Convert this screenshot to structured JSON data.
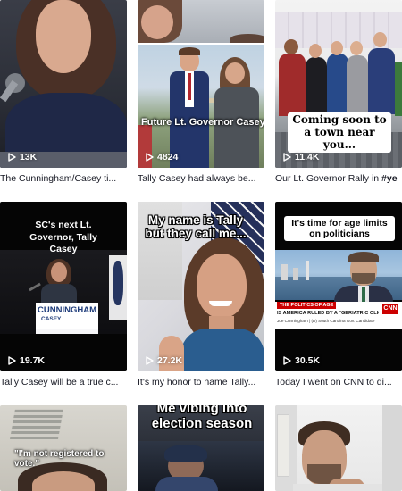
{
  "videos": [
    {
      "views": "13K",
      "caption": "The Cunningham/Casey ti...",
      "caption_highlight": ""
    },
    {
      "views": "4824",
      "caption": "Tally Casey had always be...",
      "caption_highlight": "",
      "overlay": "Future Lt. Governor Casey"
    },
    {
      "views": "11.4K",
      "caption": "Our Lt. Governor Rally in ",
      "caption_highlight": "#ye",
      "overlay": "Coming soon to a town near you..."
    },
    {
      "views": "19.7K",
      "caption": "Tally Casey will be a true c...",
      "caption_highlight": "",
      "overlay": "SC's next Lt. Governor, Tally Casey",
      "podium_top": "CUNNINGHAM",
      "podium_bottom": "CASEY"
    },
    {
      "views": "27.2K",
      "caption": "It's my honor to name Tally...",
      "caption_highlight": "",
      "overlay": "My name is Tally but they call me..."
    },
    {
      "views": "30.5K",
      "caption": "Today I went on CNN to di...",
      "caption_highlight": "",
      "overlay": "It's time for age limits on politicians",
      "chyron_red": "THE POLITICS OF AGE",
      "chyron_main": "IS AMERICA RULED BY A \"GERIATRIC OLIGARCHY?\"",
      "chyron_sub": "Joe Cunningham | (D) South Carolina Gov. Candidate",
      "network": "CNN"
    },
    {
      "overlay": "\"I'm not registered to vote.\""
    },
    {
      "overlay": "Me vibing into election season"
    },
    {}
  ],
  "colors": {
    "text": "#161823",
    "background": "#ffffff",
    "overlay_white": "#ffffff",
    "cnn_red": "#cc0000"
  },
  "icons": {
    "views": "play-icon"
  }
}
